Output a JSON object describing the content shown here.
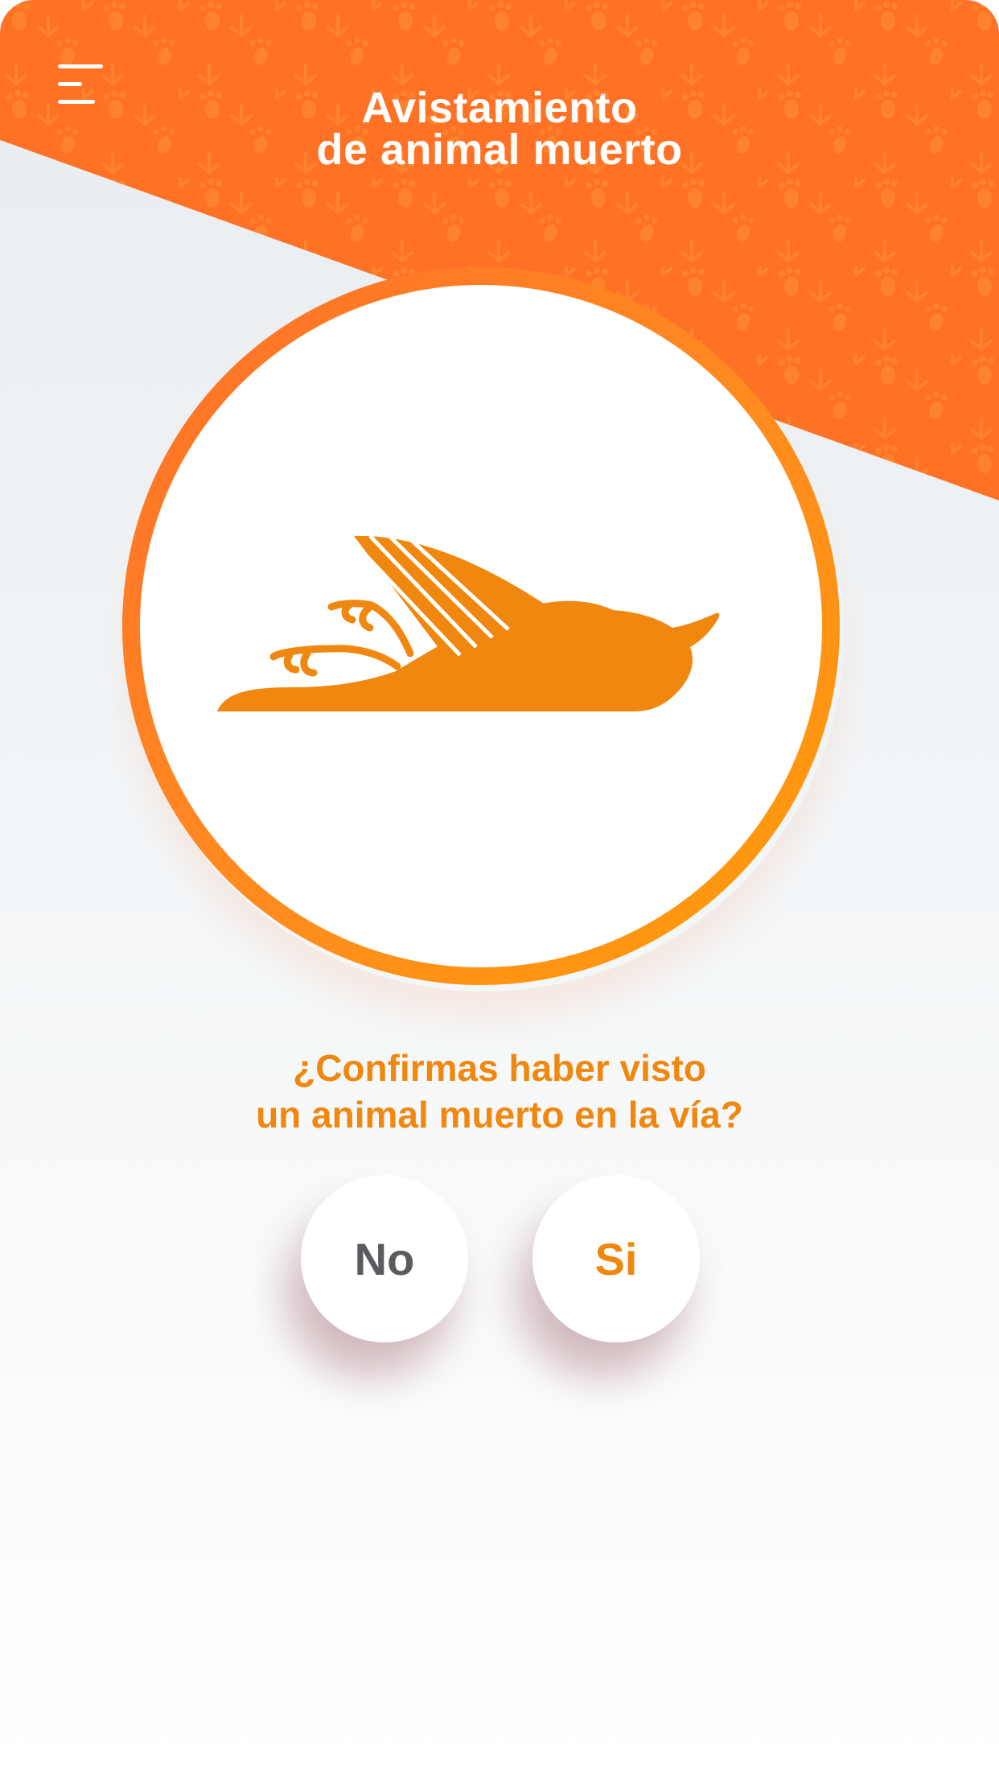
{
  "header": {
    "menu_icon": "menu-icon",
    "title_line1": "Avistamiento",
    "title_line2": "de animal muerto",
    "banner_color": "#ff7226",
    "pattern": "animal-tracks-pattern"
  },
  "illustration": {
    "icon": "dead-bird-icon",
    "ring_color": "#ff8a20",
    "icon_color": "#f0870f"
  },
  "prompt": {
    "line1": "¿Confirmas haber visto",
    "line2": "un animal muerto en la vía?"
  },
  "actions": {
    "no_label": "No",
    "yes_label": "Si"
  }
}
